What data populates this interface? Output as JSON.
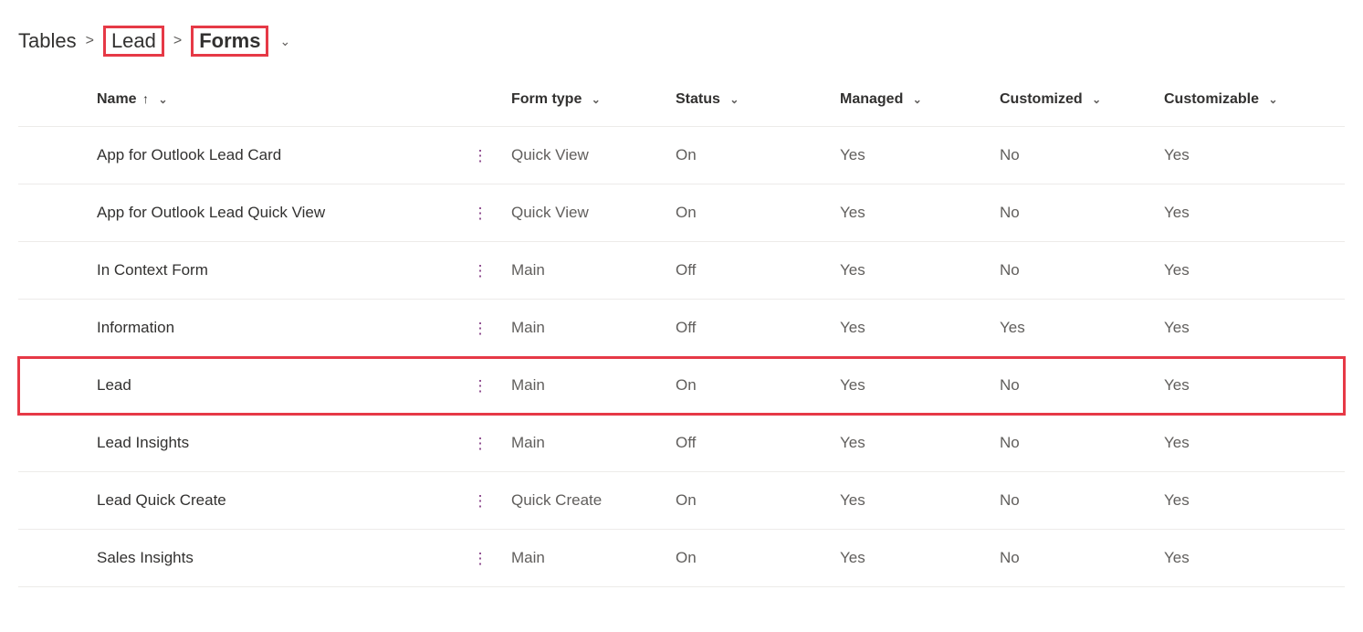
{
  "breadcrumb": {
    "root": "Tables",
    "mid": "Lead",
    "current": "Forms"
  },
  "columns": {
    "name": "Name",
    "formType": "Form type",
    "status": "Status",
    "managed": "Managed",
    "customized": "Customized",
    "customizable": "Customizable"
  },
  "sortIndicator": "↑",
  "rows": [
    {
      "name": "App for Outlook Lead Card",
      "formType": "Quick View",
      "status": "On",
      "managed": "Yes",
      "customized": "No",
      "customizable": "Yes",
      "highlight": false
    },
    {
      "name": "App for Outlook Lead Quick View",
      "formType": "Quick View",
      "status": "On",
      "managed": "Yes",
      "customized": "No",
      "customizable": "Yes",
      "highlight": false
    },
    {
      "name": "In Context Form",
      "formType": "Main",
      "status": "Off",
      "managed": "Yes",
      "customized": "No",
      "customizable": "Yes",
      "highlight": false
    },
    {
      "name": "Information",
      "formType": "Main",
      "status": "Off",
      "managed": "Yes",
      "customized": "Yes",
      "customizable": "Yes",
      "highlight": false
    },
    {
      "name": "Lead",
      "formType": "Main",
      "status": "On",
      "managed": "Yes",
      "customized": "No",
      "customizable": "Yes",
      "highlight": true
    },
    {
      "name": "Lead Insights",
      "formType": "Main",
      "status": "Off",
      "managed": "Yes",
      "customized": "No",
      "customizable": "Yes",
      "highlight": false
    },
    {
      "name": "Lead Quick Create",
      "formType": "Quick Create",
      "status": "On",
      "managed": "Yes",
      "customized": "No",
      "customizable": "Yes",
      "highlight": false
    },
    {
      "name": "Sales Insights",
      "formType": "Main",
      "status": "On",
      "managed": "Yes",
      "customized": "No",
      "customizable": "Yes",
      "highlight": false
    }
  ]
}
